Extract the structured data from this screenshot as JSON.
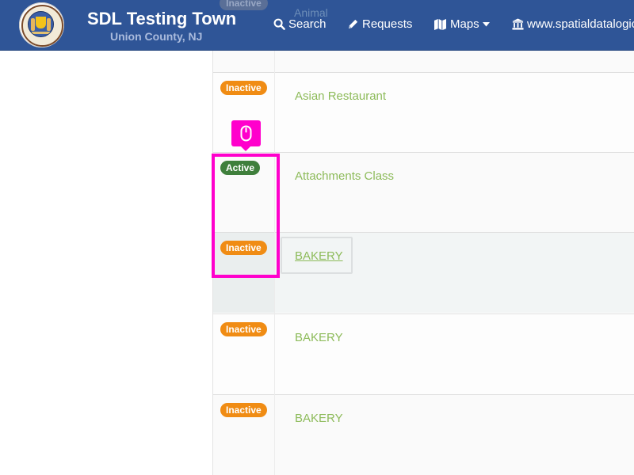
{
  "header": {
    "title": "SDL Testing Town",
    "subtitle": "Union County, NJ",
    "seal_icon": "state-seal-icon",
    "background_color": "#2f5597"
  },
  "nav": [
    {
      "icon": "search-icon",
      "label": "Search"
    },
    {
      "icon": "pencil-icon",
      "label": "Requests"
    },
    {
      "icon": "map-icon",
      "label": "Maps",
      "caret": "chevron-down-icon"
    },
    {
      "icon": "bank-icon",
      "label": "www.spatialdatalogic"
    }
  ],
  "behind_header": {
    "status": "Inactive",
    "name": "Animal"
  },
  "rows": [
    {
      "status": "Inactive",
      "name": "Asian Restaurant"
    },
    {
      "status": "Active",
      "name": "Attachments Class"
    },
    {
      "status": "Inactive",
      "name": "BAKERY"
    },
    {
      "status": "Inactive",
      "name": "BAKERY"
    },
    {
      "status": "Inactive",
      "name": "BAKERY"
    }
  ],
  "colors": {
    "inactive_badge": "#f08c14",
    "active_badge": "#3f7f3c",
    "link_text": "#8dbb5a",
    "highlight": "#ff00cc"
  },
  "overlay": {
    "icon": "mouse-icon"
  }
}
